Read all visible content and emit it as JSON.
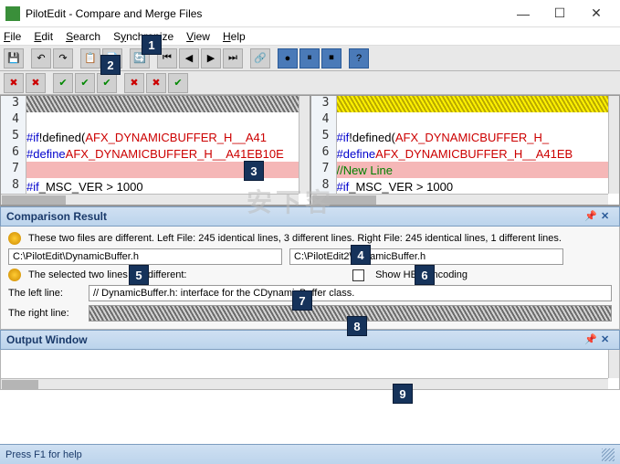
{
  "window": {
    "title": "PilotEdit - Compare and Merge Files"
  },
  "menu": {
    "file": "File",
    "edit": "Edit",
    "search": "Search",
    "synchronize": "Synchronize",
    "view": "View",
    "help": "Help"
  },
  "left_pane": {
    "lines": {
      "l3": "3",
      "l4": "4",
      "l5": "5",
      "l6": "6",
      "l7": "7",
      "l8": "8"
    },
    "code": {
      "c5_if": "#if",
      "c5_rest_a": " !defined(",
      "c5_rest_b": "AFX_DYNAMICBUFFER_H__A41",
      "c6_def": "#define",
      "c6_rest": " AFX_DYNAMICBUFFER_H__A41EB10E",
      "c8_if": "#if",
      "c8_rest": " _MSC_VER > 1000"
    }
  },
  "right_pane": {
    "lines": {
      "l3": "3",
      "l4": "4",
      "l5": "5",
      "l6": "6",
      "l7": "7",
      "l8": "8"
    },
    "code": {
      "c5_if": "#if",
      "c5_rest_a": " !defined(",
      "c5_rest_b": "AFX_DYNAMICBUFFER_H_",
      "c6_def": "#define",
      "c6_rest": " AFX_DYNAMICBUFFER_H__A41EB",
      "c7": "//New Line",
      "c8_if": "#if",
      "c8_rest": " _MSC_VER > 1000"
    }
  },
  "comparison": {
    "header": "Comparison Result",
    "summary": "These two files are different. Left File: 245 identical lines, 3 different lines. Right File: 245 identical lines, 1 different lines.",
    "left_file": "C:\\PilotEdit\\DynamicBuffer.h",
    "right_file": "C:\\PilotEdit2\\DynamicBuffer.h",
    "selected_msg": "The selected two lines are different:",
    "show_hex": "Show HEX encoding",
    "left_line_label": "The left line:",
    "left_line_value": "// DynamicBuffer.h: interface for the CDynamicBuffer class.",
    "right_line_label": "The right line:"
  },
  "output": {
    "header": "Output Window"
  },
  "status": {
    "text": "Press F1 for help"
  },
  "markers": {
    "m1": "1",
    "m2": "2",
    "m3": "3",
    "m4": "4",
    "m5": "5",
    "m6": "6",
    "m7": "7",
    "m8": "8",
    "m9": "9"
  },
  "watermark": "安下客"
}
